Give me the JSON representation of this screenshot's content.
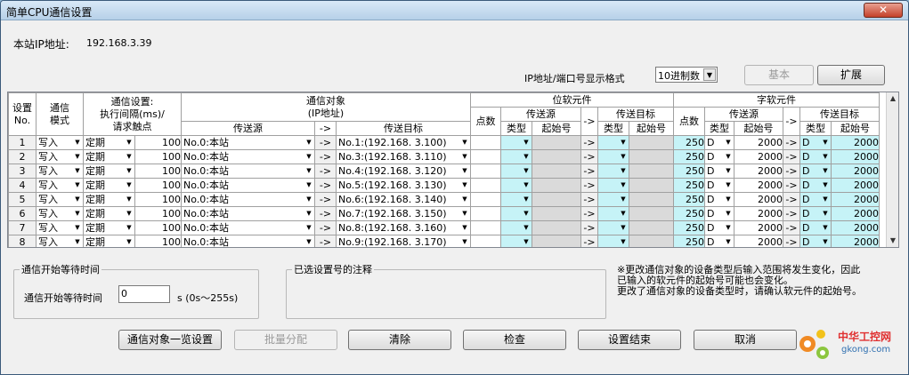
{
  "window": {
    "title": "简单CPU通信设置",
    "close_label": "✕"
  },
  "station": {
    "ip_label": "本站IP地址:",
    "ip_value": "192.168.3.39"
  },
  "format": {
    "label": "IP地址/端口号显示格式",
    "selected": "10进制数"
  },
  "top_buttons": {
    "basic": "基本",
    "expand": "扩展"
  },
  "table": {
    "headers": {
      "setting_no": "设置\nNo.",
      "comm_mode": "通信\n模式",
      "comm_setting": "通信设置:\n执行间隔(ms)/\n请求触点",
      "comm_target": "通信对象\n(IP地址)",
      "source": "传送源",
      "arrow": "->",
      "dest": "传送目标",
      "bit_device": "位软元件",
      "word_device": "字软元件",
      "points": "点数",
      "type": "类型",
      "start_no": "起始号"
    },
    "rows": [
      {
        "no": "1",
        "mode": "写入",
        "timing": "定期",
        "interval": "100",
        "source": "No.0:本站",
        "arrow": "->",
        "dest": "No.1:(192.168. 3.100)",
        "bit_arrow": "->",
        "word_points": "250",
        "src_type": "D",
        "src_start": "2000",
        "word_arrow": "->",
        "dst_type": "D",
        "dst_start": "2000"
      },
      {
        "no": "2",
        "mode": "写入",
        "timing": "定期",
        "interval": "100",
        "source": "No.0:本站",
        "arrow": "->",
        "dest": "No.3:(192.168. 3.110)",
        "bit_arrow": "->",
        "word_points": "250",
        "src_type": "D",
        "src_start": "2000",
        "word_arrow": "->",
        "dst_type": "D",
        "dst_start": "2000"
      },
      {
        "no": "3",
        "mode": "写入",
        "timing": "定期",
        "interval": "100",
        "source": "No.0:本站",
        "arrow": "->",
        "dest": "No.4:(192.168. 3.120)",
        "bit_arrow": "->",
        "word_points": "250",
        "src_type": "D",
        "src_start": "2000",
        "word_arrow": "->",
        "dst_type": "D",
        "dst_start": "2000"
      },
      {
        "no": "4",
        "mode": "写入",
        "timing": "定期",
        "interval": "100",
        "source": "No.0:本站",
        "arrow": "->",
        "dest": "No.5:(192.168. 3.130)",
        "bit_arrow": "->",
        "word_points": "250",
        "src_type": "D",
        "src_start": "2000",
        "word_arrow": "->",
        "dst_type": "D",
        "dst_start": "2000"
      },
      {
        "no": "5",
        "mode": "写入",
        "timing": "定期",
        "interval": "100",
        "source": "No.0:本站",
        "arrow": "->",
        "dest": "No.6:(192.168. 3.140)",
        "bit_arrow": "->",
        "word_points": "250",
        "src_type": "D",
        "src_start": "2000",
        "word_arrow": "->",
        "dst_type": "D",
        "dst_start": "2000"
      },
      {
        "no": "6",
        "mode": "写入",
        "timing": "定期",
        "interval": "100",
        "source": "No.0:本站",
        "arrow": "->",
        "dest": "No.7:(192.168. 3.150)",
        "bit_arrow": "->",
        "word_points": "250",
        "src_type": "D",
        "src_start": "2000",
        "word_arrow": "->",
        "dst_type": "D",
        "dst_start": "2000"
      },
      {
        "no": "7",
        "mode": "写入",
        "timing": "定期",
        "interval": "100",
        "source": "No.0:本站",
        "arrow": "->",
        "dest": "No.8:(192.168. 3.160)",
        "bit_arrow": "->",
        "word_points": "250",
        "src_type": "D",
        "src_start": "2000",
        "word_arrow": "->",
        "dst_type": "D",
        "dst_start": "2000"
      },
      {
        "no": "8",
        "mode": "写入",
        "timing": "定期",
        "interval": "100",
        "source": "No.0:本站",
        "arrow": "->",
        "dest": "No.9:(192.168. 3.170)",
        "bit_arrow": "->",
        "word_points": "250",
        "src_type": "D",
        "src_start": "2000",
        "word_arrow": "->",
        "dst_type": "D",
        "dst_start": "2000"
      }
    ]
  },
  "wait_group": {
    "legend": "通信开始等待时间",
    "label": "通信开始等待时间",
    "value": "0",
    "unit": "s (0s～255s)"
  },
  "comment_group": {
    "legend": "已选设置号的注释"
  },
  "note": {
    "line1": "※更改通信对象的设备类型后输入范围将发生变化，因此",
    "line2": "已输入的软元件的起始号可能也会变化。",
    "line3": "更改了通信对象的设备类型时，请确认软元件的起始号。"
  },
  "bottom_buttons": {
    "list": "通信对象一览设置",
    "batch": "批量分配",
    "clear": "清除",
    "check": "检查",
    "finish": "设置结束",
    "cancel": "取消"
  },
  "watermark": {
    "brand": "中华工控网",
    "domain": "gkong.com"
  }
}
